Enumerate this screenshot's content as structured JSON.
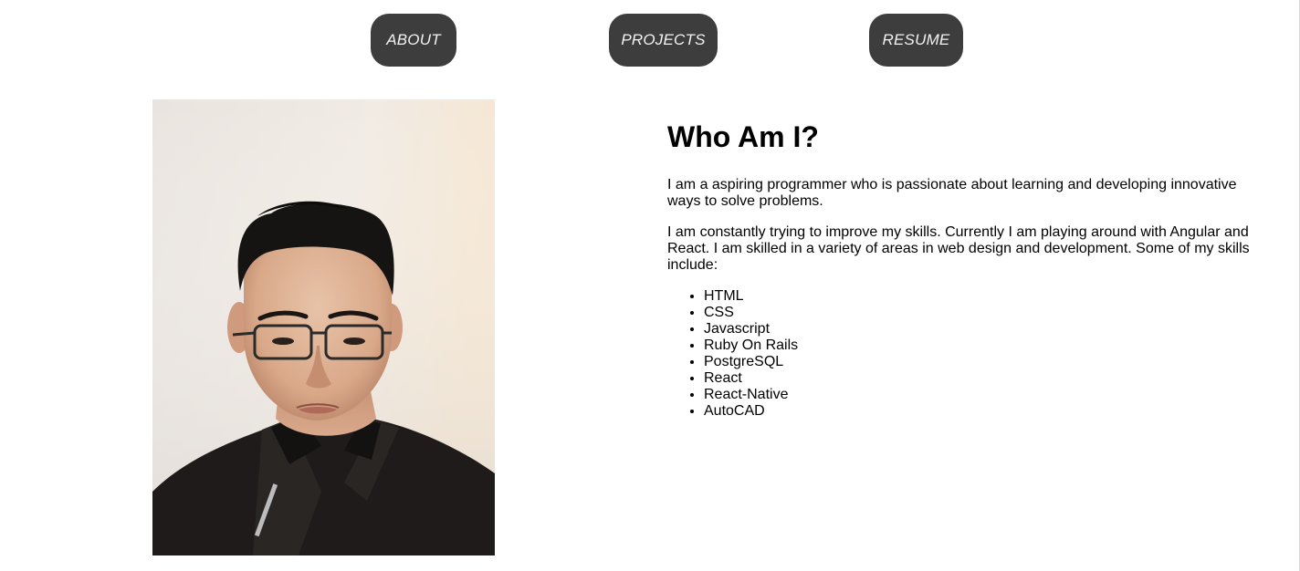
{
  "nav": {
    "about_label": "ABOUT",
    "projects_label": "PROJECTS",
    "resume_label": "RESUME"
  },
  "about": {
    "heading": "Who Am I?",
    "paragraph_1": "I am a aspiring programmer who is passionate about learning and developing innovative ways to solve problems.",
    "paragraph_2": "I am constantly trying to improve my skills. Currently I am playing around with Angular and React. I am skilled in a variety of areas in web design and development. Some of my skills include:",
    "skills": [
      "HTML",
      "CSS",
      "Javascript",
      "Ruby On Rails",
      "PostgreSQL",
      "React",
      "React-Native",
      "AutoCAD"
    ]
  },
  "colors": {
    "nav_button_bg": "#3d3d3d",
    "nav_button_text": "#f2f2f2",
    "page_bg": "#ffffff"
  }
}
